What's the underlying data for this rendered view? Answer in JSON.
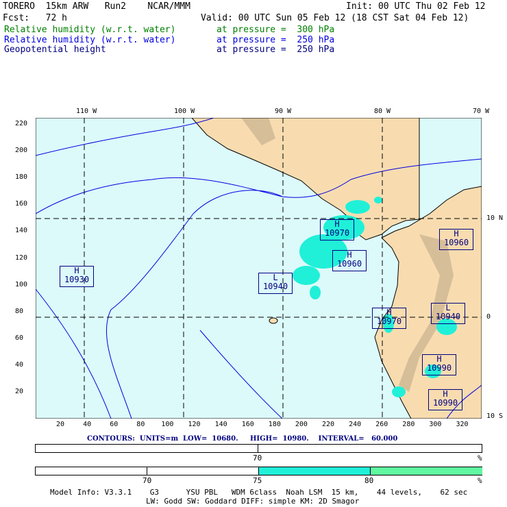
{
  "header": {
    "line1_left": "TORERO  15km ARW   Run2    NCAR/MMM",
    "init": "Init: 00 UTC Thu 02 Feb 12",
    "fcst": "Fcst:   72 h",
    "valid": "Valid: 00 UTC Sun 05 Feb 12 (18 CST Sat 04 Feb 12)",
    "fields": [
      {
        "name": "Relative humidity (w.r.t. water)",
        "level": "at pressure =  300 hPa",
        "color": "#008000"
      },
      {
        "name": "Relative humidity (w.r.t. water)",
        "level": "at pressure =  250 hPa",
        "color": "#0000e0"
      },
      {
        "name": "Geopotential height",
        "level": "at pressure =  250 hPa",
        "color": "#000080"
      }
    ]
  },
  "map": {
    "top_lon_labels": [
      "110 W",
      "100 W",
      "90 W",
      "80 W",
      "70 W"
    ],
    "right_lat_labels": [
      "10 N",
      "0",
      "10 S"
    ],
    "left_y_ticks": [
      "220",
      "200",
      "180",
      "160",
      "140",
      "120",
      "100",
      "80",
      "60",
      "40",
      "20"
    ],
    "bottom_x_ticks": [
      "20",
      "40",
      "60",
      "80",
      "100",
      "120",
      "140",
      "160",
      "180",
      "200",
      "220",
      "240",
      "260",
      "280",
      "300",
      "320"
    ],
    "centers": [
      {
        "type": "H",
        "value": "10930"
      },
      {
        "type": "L",
        "value": "10940"
      },
      {
        "type": "H",
        "value": "10970"
      },
      {
        "type": "H",
        "value": "10960"
      },
      {
        "type": "H",
        "value": "10970"
      },
      {
        "type": "L",
        "value": "10940"
      },
      {
        "type": "H",
        "value": "10960"
      },
      {
        "type": "H",
        "value": "10990"
      },
      {
        "type": "H",
        "value": "10990"
      }
    ]
  },
  "contour_info": "CONTOURS:  UNITS=m  LOW=  10680.     HIGH=  10980.    INTERVAL=   60.000",
  "legend1": {
    "labels": [
      "70"
    ],
    "unit": "%"
  },
  "legend2": {
    "labels": [
      "70",
      "75",
      "80"
    ],
    "unit": "%",
    "colors": [
      "#20f0d8",
      "#60f8a0"
    ]
  },
  "footer": {
    "line1": "Model Info: V3.3.1    G3      YSU PBL   WDM 6class  Noah LSM  15 km,    44 levels,    62 sec",
    "line2": "LW: Godd SW: Goddard DIFF: simple KM: 2D Smagor"
  }
}
